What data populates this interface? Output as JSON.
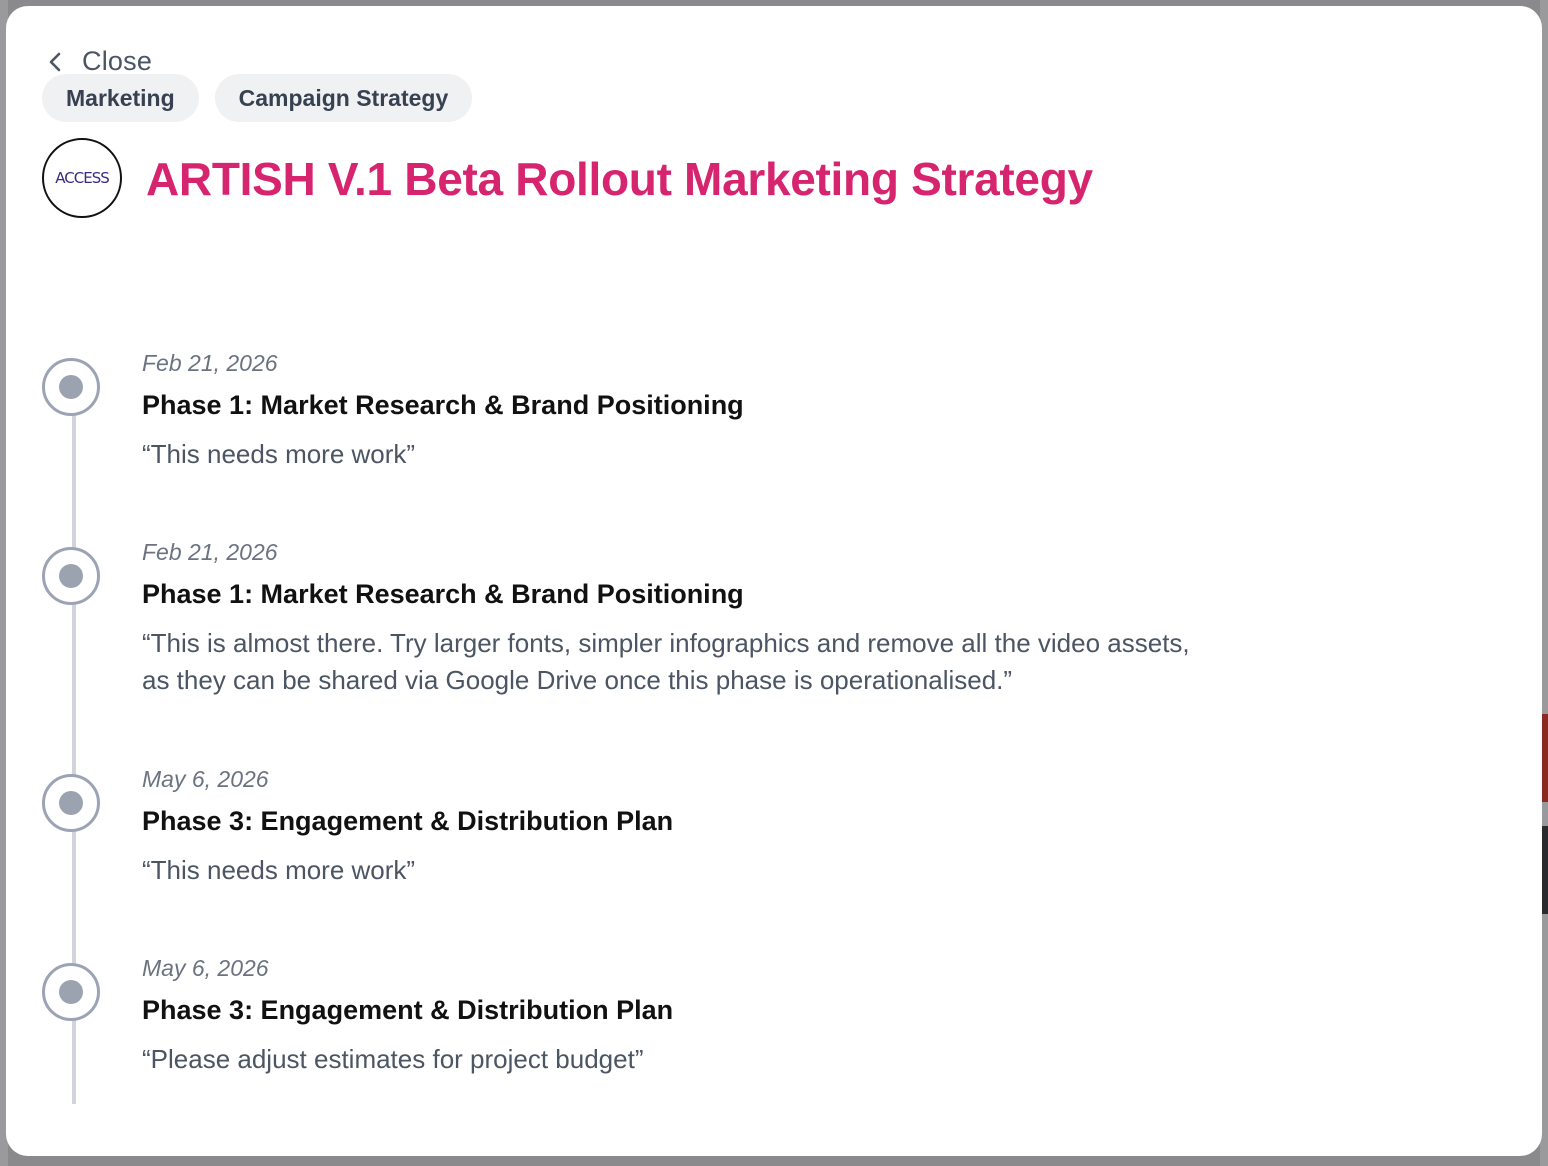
{
  "modal": {
    "close_label": "Close",
    "tags": [
      "Marketing",
      "Campaign Strategy"
    ],
    "logo_text": "ACCESS",
    "title": "ARTISH V.1 Beta Rollout Marketing Strategy"
  },
  "timeline": [
    {
      "date": "Feb 21, 2026",
      "phase": "Phase 1: Market Research & Brand Positioning",
      "comment": "“This needs more work”"
    },
    {
      "date": "Feb 21, 2026",
      "phase": "Phase 1: Market Research & Brand Positioning",
      "comment": "“This is almost there. Try larger fonts, simpler infographics and remove all the video assets, as they can be shared via Google Drive once this phase is operationalised.”"
    },
    {
      "date": "May 6, 2026",
      "phase": "Phase 3: Engagement & Distribution Plan",
      "comment": "“This needs more work”"
    },
    {
      "date": "May 6, 2026",
      "phase": "Phase 3: Engagement & Distribution Plan",
      "comment": "“Please adjust estimates for project budget”"
    }
  ],
  "colors": {
    "title": "#d6246f",
    "logo_text": "#3b2a83",
    "marker": "#9ca3b0",
    "timeline_line": "#d1d5db"
  },
  "icons": {
    "close": "chevron-left-icon",
    "marker": "timeline-dot-icon"
  }
}
